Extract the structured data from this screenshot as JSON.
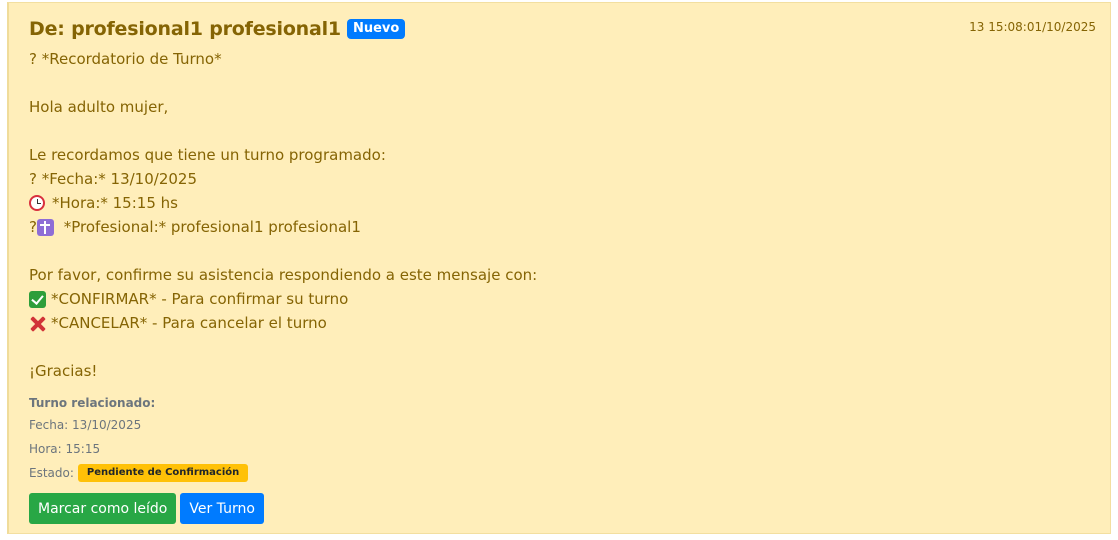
{
  "message": {
    "from_label": "De: profesional1 profesional1",
    "new_badge": "Nuevo",
    "timestamp": "13 15:08:01/10/2025",
    "lines": {
      "reminder_prefix": "? *Recordatorio de Turno*",
      "greeting": "Hola adulto mujer,",
      "intro": "Le recordamos que tiene un turno programado:",
      "date_line": "? *Fecha:* 13/10/2025",
      "time_line": "*Hora:* 15:15 hs",
      "professional_prefix": "?",
      "professional_line": " *Profesional:* profesional1 profesional1",
      "confirm_request": "Por favor, confirme su asistencia respondiendo a este mensaje con:",
      "confirm_option": "*CONFIRMAR* - Para confirmar su turno",
      "cancel_option": "*CANCELAR* - Para cancelar el turno",
      "thanks": "¡Gracias!"
    },
    "icons": {
      "alarm": "alarm-clock-icon",
      "medical": "medical-symbol-icon",
      "check": "check-mark-icon",
      "cross": "cross-mark-icon"
    }
  },
  "related": {
    "title": "Turno relacionado:",
    "date": "Fecha: 13/10/2025",
    "time": "Hora: 15:15",
    "status_label": "Estado:",
    "status_value": "Pendiente de Confirmación"
  },
  "actions": {
    "mark_read": "Marcar como leído",
    "view_turn": "Ver Turno"
  },
  "colors": {
    "card_bg": "#ffeeba",
    "text": "#856404",
    "primary": "#007bff",
    "success": "#28a745",
    "warning": "#ffc107"
  }
}
